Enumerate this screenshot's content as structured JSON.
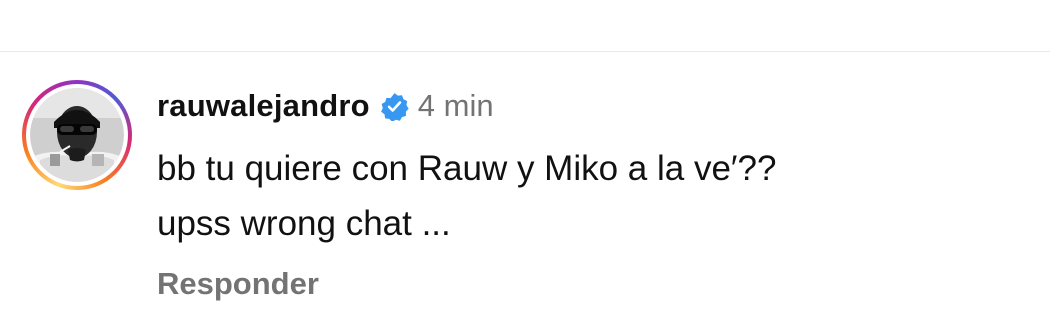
{
  "comment": {
    "username": "rauwalejandro",
    "verified_icon": "verified-badge-icon",
    "time": "4 min",
    "lines": [
      "bb tu quiere con Rauw y Miko a la ve′??",
      "upss wrong chat ..."
    ],
    "reply_label": "Responder"
  },
  "colors": {
    "verified": "#3897f0",
    "secondary_text": "#737373",
    "divider": "#e9e9e9"
  }
}
